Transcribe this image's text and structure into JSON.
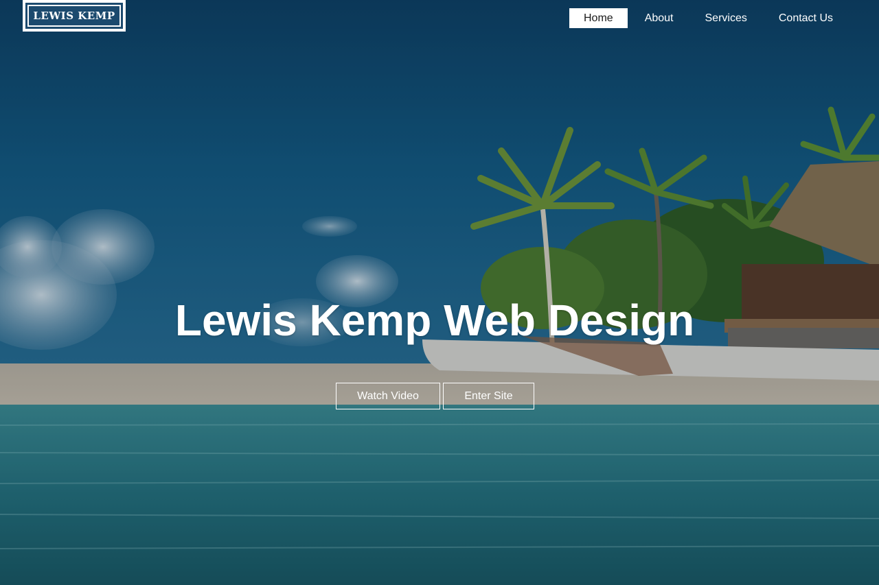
{
  "brand": {
    "logo_text": "LEWIS KEMP"
  },
  "nav": {
    "items": [
      {
        "label": "Home",
        "active": true
      },
      {
        "label": "About",
        "active": false
      },
      {
        "label": "Services",
        "active": false
      },
      {
        "label": "Contact Us",
        "active": false
      }
    ]
  },
  "hero": {
    "title": "Lewis Kemp Web Design",
    "buttons": {
      "watch_video": "Watch Video",
      "enter_site": "Enter Site"
    }
  },
  "colors": {
    "sky": "#0f4a72",
    "sea": "#2f7f8a",
    "sand": "#c7b9a6",
    "nav_active_bg": "#ffffff",
    "text": "#ffffff"
  }
}
